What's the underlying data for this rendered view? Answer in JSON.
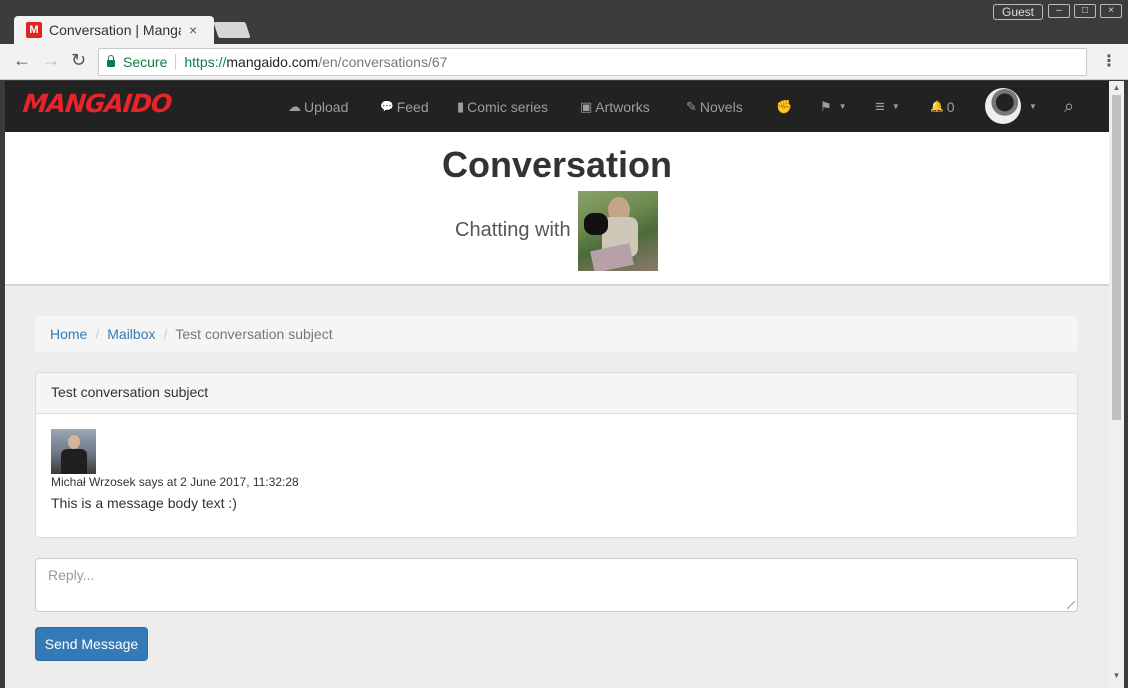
{
  "browser": {
    "tab_title": "Conversation | Mangaido",
    "tab_favicon": "M",
    "tab_close": "×",
    "profile": "Guest",
    "window_controls": [
      "–",
      "□",
      "×"
    ],
    "nav_icons": {
      "back": "←",
      "forward": "→",
      "reload": "↻",
      "menu": "⋮"
    },
    "secure_label": "Secure",
    "url_scheme": "https://",
    "url_host": "mangaido.com",
    "url_path": "/en/conversations/67"
  },
  "site": {
    "logo": "MANGAIDO",
    "logo_color": "#e8232a",
    "nav": [
      {
        "icon": "cloud-upload-icon",
        "glyph": "☁",
        "label": "Upload"
      },
      {
        "icon": "comments-icon",
        "glyph": "💬",
        "label": "Feed"
      },
      {
        "icon": "book-icon",
        "glyph": "▮",
        "label": "Comic series"
      },
      {
        "icon": "picture-icon",
        "glyph": "▣",
        "label": "Artworks"
      },
      {
        "icon": "edit-icon",
        "glyph": "✎",
        "label": "Novels"
      },
      {
        "icon": "grab-icon",
        "glyph": "✊",
        "label": ""
      },
      {
        "icon": "flag-icon",
        "glyph": "⚑",
        "label": ""
      },
      {
        "icon": "menu-icon",
        "glyph": "≡",
        "label": ""
      },
      {
        "icon": "bell-icon",
        "glyph": "🔔",
        "label": "0"
      }
    ],
    "search_glyph": "⌕"
  },
  "header": {
    "title": "Conversation",
    "chatting_with": "Chatting with"
  },
  "breadcrumb": {
    "items": [
      "Home",
      "Mailbox"
    ],
    "separator": "/",
    "active": "Test conversation subject"
  },
  "conversation": {
    "subject": "Test conversation subject",
    "message": {
      "meta": "Michał Wrzosek says at 2 June 2017, 11:32:28",
      "body": "This is a message body text :)"
    }
  },
  "reply": {
    "placeholder": "Reply...",
    "send_label": "Send Message",
    "button_color": "#337ab7"
  }
}
